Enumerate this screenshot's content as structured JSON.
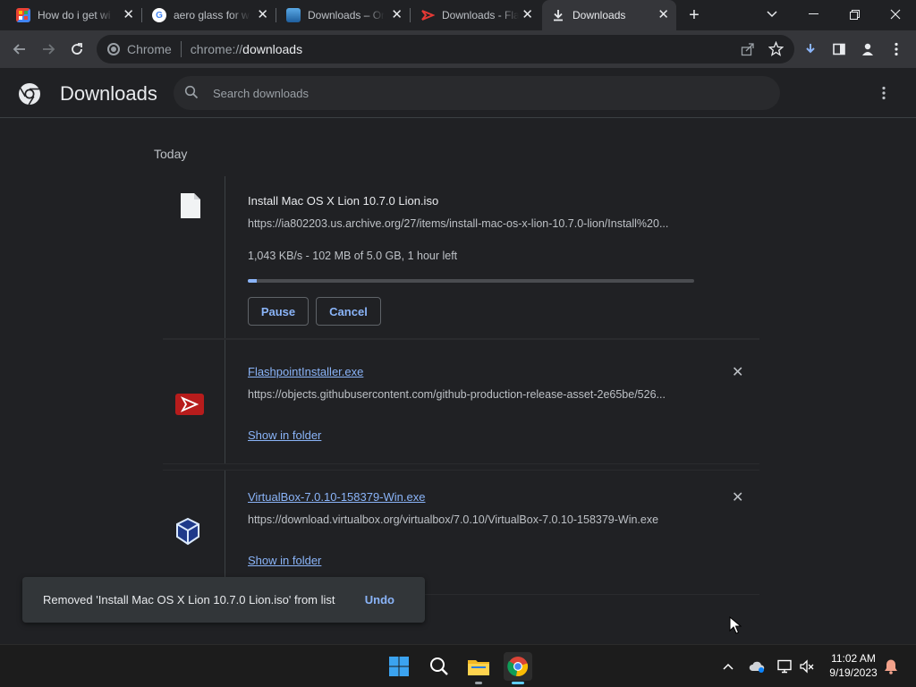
{
  "tabs": [
    {
      "title": "How do i get wi",
      "favicon": "puzzle-icon"
    },
    {
      "title": "aero glass for w",
      "favicon": "google-icon"
    },
    {
      "title": "Downloads – Or",
      "favicon": "image-icon"
    },
    {
      "title": "Downloads - Fla",
      "favicon": "flashpoint-icon"
    },
    {
      "title": "Downloads",
      "favicon": "download-icon"
    }
  ],
  "omnibox": {
    "prefix": "Chrome",
    "scheme": "chrome://",
    "host": "downloads"
  },
  "page": {
    "title": "Downloads",
    "search_placeholder": "Search downloads"
  },
  "section": {
    "label": "Today"
  },
  "downloads": [
    {
      "name": "Install Mac OS X Lion 10.7.0 Lion.iso",
      "url": "https://ia802203.us.archive.org/27/items/install-mac-os-x-lion-10.7.0-lion/Install%20...",
      "status": "1,043 KB/s - 102 MB of 5.0 GB, 1 hour left",
      "progress": 0.02,
      "pause_label": "Pause",
      "cancel_label": "Cancel"
    },
    {
      "name": "FlashpointInstaller.exe",
      "url": "https://objects.githubusercontent.com/github-production-release-asset-2e65be/526...",
      "action_label": "Show in folder"
    },
    {
      "name": "VirtualBox-7.0.10-158379-Win.exe",
      "url": "https://download.virtualbox.org/virtualbox/7.0.10/VirtualBox-7.0.10-158379-Win.exe",
      "action_label": "Show in folder"
    }
  ],
  "toast": {
    "message": "Removed 'Install Mac OS X Lion 10.7.0 Lion.iso' from list",
    "undo_label": "Undo"
  },
  "taskbar": {
    "time": "11:02 AM",
    "date": "9/19/2023"
  },
  "colors": {
    "accent": "#8ab4f8",
    "background": "#202124",
    "toolbar": "#35363a"
  }
}
